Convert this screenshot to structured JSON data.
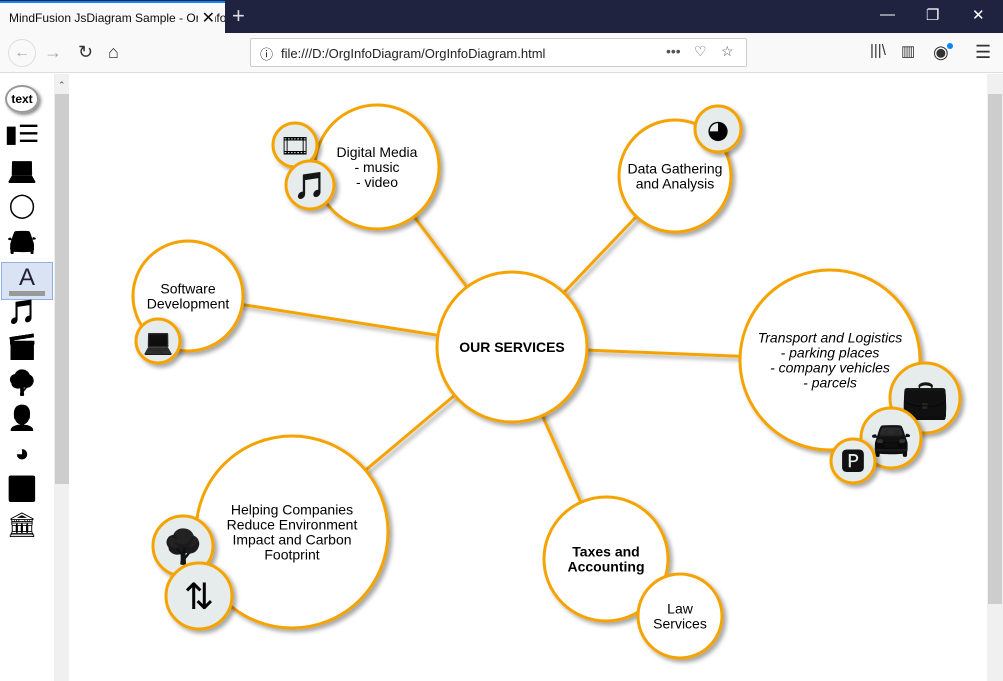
{
  "browser": {
    "tab_title": "MindFusion JsDiagram Sample - OrgInfoDiagram",
    "url": "file:///D:/OrgInfoDiagram/OrgInfoDiagram.html"
  },
  "palette": {
    "items": [
      {
        "label": "text",
        "icon": "text-bubble-icon"
      },
      {
        "icon": "newspaper-icon"
      },
      {
        "icon": "laptop-icon"
      },
      {
        "icon": "ring-icon"
      },
      {
        "icon": "car-icon"
      },
      {
        "label": "A",
        "icon": "text-format-icon",
        "selected": true
      },
      {
        "icon": "music-library-icon"
      },
      {
        "icon": "clapperboard-icon"
      },
      {
        "icon": "person-tree-icon"
      },
      {
        "icon": "contact-card-icon"
      },
      {
        "icon": "pie-chart-icon"
      },
      {
        "icon": "router-icon"
      },
      {
        "icon": "bank-icon"
      }
    ]
  },
  "diagram": {
    "accent": "#f5a300",
    "center": {
      "label": "OUR SERVICES"
    },
    "nodes": [
      {
        "id": "media",
        "lines": [
          "Digital Media",
          "- music",
          "- video"
        ],
        "icons": [
          "film-icon",
          "music-icon"
        ]
      },
      {
        "id": "data",
        "lines": [
          "Data Gathering",
          "and Analysis"
        ],
        "icons": [
          "pie-chart-icon"
        ]
      },
      {
        "id": "software",
        "lines": [
          "Software",
          "Development"
        ],
        "icons": [
          "laptop-icon"
        ]
      },
      {
        "id": "transport",
        "lines": [
          "Transport and Logistics",
          "- parking places",
          "- company vehicles",
          "- parcels"
        ],
        "italic": true,
        "icons": [
          "briefcase-icon",
          "car-icon",
          "parking-icon"
        ]
      },
      {
        "id": "env",
        "lines": [
          "Helping Companies",
          "Reduce Environment",
          "Impact and Carbon",
          "Footprint"
        ],
        "icons": [
          "person-tree-icon",
          "recycle-arrows-icon"
        ]
      },
      {
        "id": "tax",
        "lines": [
          "Taxes and",
          "Accounting"
        ],
        "bold": true,
        "icons": []
      },
      {
        "id": "law",
        "lines": [
          "Law",
          "Services"
        ],
        "icons": []
      }
    ]
  }
}
